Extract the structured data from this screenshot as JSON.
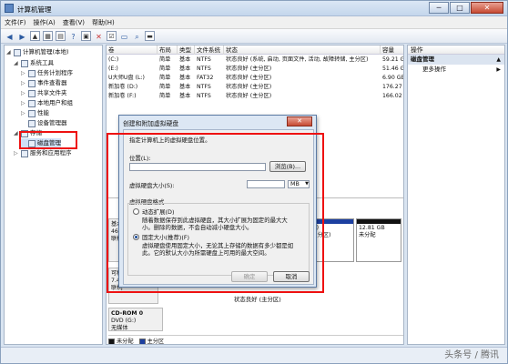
{
  "window": {
    "title": "计算机管理",
    "controls": {
      "minimize": "─",
      "maximize": "□",
      "close": "✕"
    }
  },
  "menu": [
    "文件(F)",
    "操作(A)",
    "查看(V)",
    "帮助(H)"
  ],
  "tree": [
    {
      "label": "计算机管理(本地)",
      "depth": 0,
      "twisty": "◢"
    },
    {
      "label": "系统工具",
      "depth": 1,
      "twisty": "◢"
    },
    {
      "label": "任务计划程序",
      "depth": 2,
      "twisty": "▷"
    },
    {
      "label": "事件查看器",
      "depth": 2,
      "twisty": "▷"
    },
    {
      "label": "共享文件夹",
      "depth": 2,
      "twisty": "▷"
    },
    {
      "label": "本地用户和组",
      "depth": 2,
      "twisty": "▷"
    },
    {
      "label": "性能",
      "depth": 2,
      "twisty": "▷"
    },
    {
      "label": "设备管理器",
      "depth": 2,
      "twisty": ""
    },
    {
      "label": "存储",
      "depth": 1,
      "twisty": "◢"
    },
    {
      "label": "磁盘管理",
      "depth": 2,
      "twisty": ""
    },
    {
      "label": "服务和应用程序",
      "depth": 1,
      "twisty": "▷"
    }
  ],
  "volumes": {
    "columns": [
      "卷",
      "布局",
      "类型",
      "文件系统",
      "状态",
      "容量"
    ],
    "rows": [
      [
        "(C:)",
        "简单",
        "基本",
        "NTFS",
        "状态良好 (系统, 启动, 页面文件, 活动, 故障转储, 主分区)",
        "59.21 G"
      ],
      [
        "(E:)",
        "简单",
        "基本",
        "NTFS",
        "状态良好 (主分区)",
        "51.46 G"
      ],
      [
        "U大师U盘 (L:)",
        "简单",
        "基本",
        "FAT32",
        "状态良好 (主分区)",
        "6.90 GE"
      ],
      [
        "新加卷 (D:)",
        "简单",
        "基本",
        "NTFS",
        "状态良好 (主分区)",
        "176.27"
      ],
      [
        "新加卷 (F:)",
        "简单",
        "基本",
        "NTFS",
        "状态良好 (主分区)",
        "166.02"
      ]
    ]
  },
  "disks": {
    "disk0": {
      "l1": "基本",
      "l2": "465",
      "l3": "联机"
    },
    "disk1": {
      "l1": "可移",
      "l2": "7.4",
      "l3": "联机"
    },
    "partF": {
      "name": "(F:)",
      "size": "",
      "status": "(主分区)"
    },
    "unalloc": {
      "size": "12.81 GB",
      "status": "未分配"
    },
    "cdrom": {
      "name": "CD-ROM 0",
      "type": "DVD (G:)",
      "status": "无媒体"
    },
    "statusRow": "状态良好 (主分区)"
  },
  "legend": [
    {
      "label": "未分配",
      "color": "#111111"
    },
    {
      "label": "主分区",
      "color": "#1c3fa0"
    }
  ],
  "actions": {
    "header": "操作",
    "section": "磁盘管理",
    "item": "更多操作",
    "arrow": "▲",
    "subarrow": "▶"
  },
  "dialog": {
    "title": "创建和附加虚拟硬盘",
    "close": "✕",
    "intro": "指定计算机上的虚拟硬盘位置。",
    "location_label": "位置(L):",
    "location_value": "",
    "browse": "浏览(B)...",
    "size_label": "虚拟硬盘大小(S):",
    "size_value": "",
    "unit": "MB",
    "format_label": "虚拟硬盘格式",
    "dynamic_label": "动态扩展(D)",
    "dynamic_desc1": "随着数据保存到此虚拟硬盘，其大小扩展为固定的最大大",
    "dynamic_desc2": "小。删除的数据，不会自动减小硬盘大小。",
    "fixed_label": "固定大小(推荐)(F)",
    "fixed_desc1": "虚拟硬盘使用固定大小，无论其上存储的数据有多少都是如",
    "fixed_desc2": "此。它的默认大小为所需硬盘上可用的最大空间。",
    "ok": "确定",
    "cancel": "取消"
  },
  "watermark": "头条号 / 腾讯"
}
